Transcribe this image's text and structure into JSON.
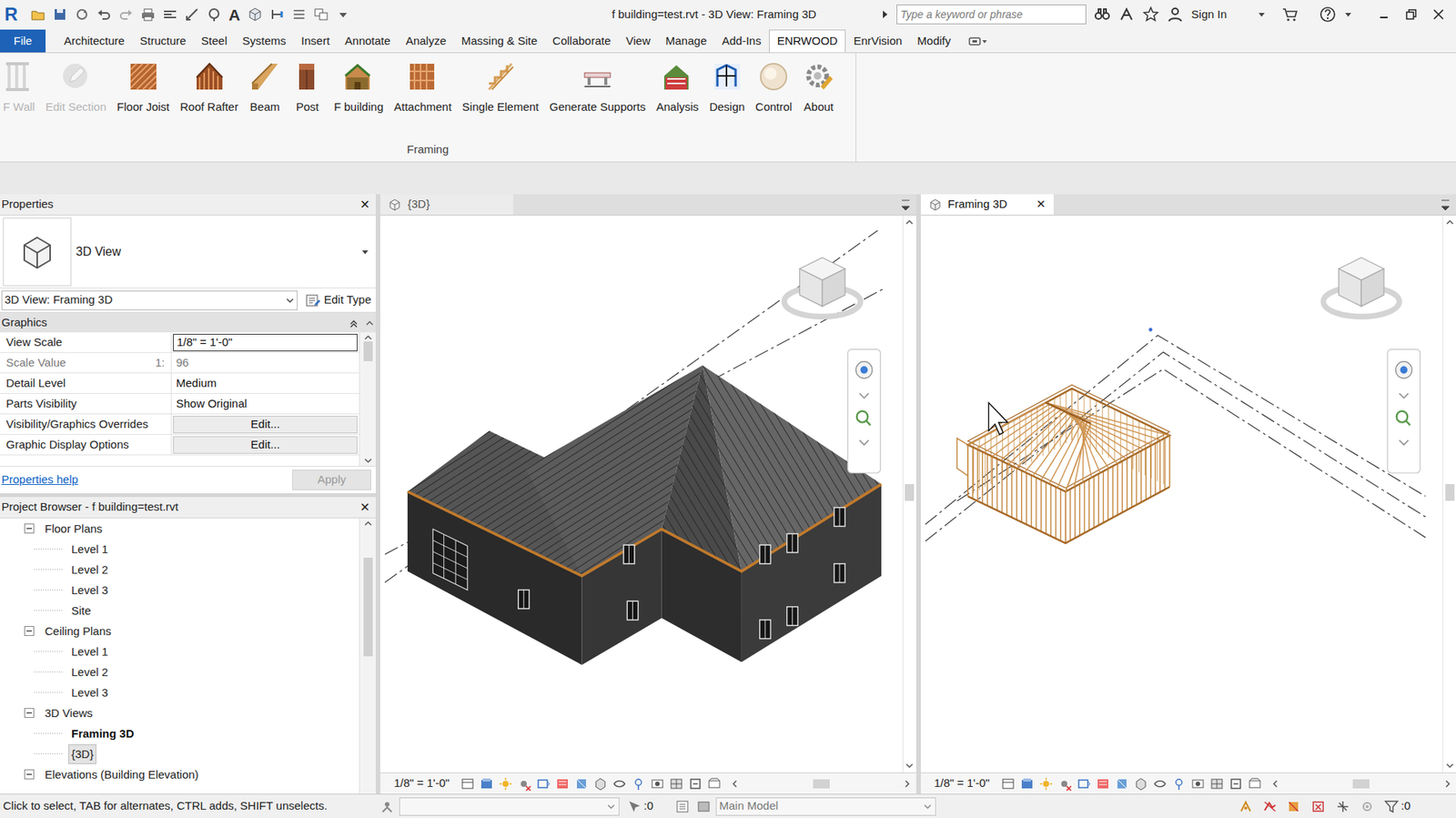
{
  "window": {
    "logo": "R",
    "text_glyph": "A",
    "title": "f building=test.rvt - 3D View: Framing 3D",
    "search_placeholder": "Type a keyword or phrase",
    "sign_in": "Sign In"
  },
  "file_tab": {
    "label": "File"
  },
  "menu_tabs": [
    {
      "label": "Architecture",
      "selected": false
    },
    {
      "label": "Structure",
      "selected": false
    },
    {
      "label": "Steel",
      "selected": false
    },
    {
      "label": "Systems",
      "selected": false
    },
    {
      "label": "Insert",
      "selected": false
    },
    {
      "label": "Annotate",
      "selected": false
    },
    {
      "label": "Analyze",
      "selected": false
    },
    {
      "label": "Massing & Site",
      "selected": false
    },
    {
      "label": "Collaborate",
      "selected": false
    },
    {
      "label": "View",
      "selected": false
    },
    {
      "label": "Manage",
      "selected": false
    },
    {
      "label": "Add-Ins",
      "selected": false
    },
    {
      "label": "ENRWOOD",
      "selected": true
    },
    {
      "label": "EnrVision",
      "selected": false
    },
    {
      "label": "Modify",
      "selected": false
    }
  ],
  "ribbon": {
    "panel": "Framing",
    "buttons": [
      {
        "label": "F Wall",
        "disabled": true
      },
      {
        "label": "Edit Section",
        "disabled": true
      },
      {
        "label": "Floor Joist",
        "disabled": false
      },
      {
        "label": "Roof Rafter",
        "disabled": false
      },
      {
        "label": "Beam",
        "disabled": false
      },
      {
        "label": "Post",
        "disabled": false
      },
      {
        "label": "F building",
        "disabled": false
      },
      {
        "label": "Attachment",
        "disabled": false
      },
      {
        "label": "Single Element",
        "disabled": false
      },
      {
        "label": "Generate Supports",
        "disabled": false
      },
      {
        "label": "Analysis",
        "disabled": false
      },
      {
        "label": "Design",
        "disabled": false
      },
      {
        "label": "Control",
        "disabled": false
      },
      {
        "label": "About",
        "disabled": false
      }
    ]
  },
  "properties": {
    "title": "Properties",
    "close": "✕",
    "type_name": "3D View",
    "instance": "3D View: Framing 3D",
    "edit_type": "Edit Type",
    "group": "Graphics",
    "rows": [
      {
        "label": "View Scale",
        "value": "1/8\" = 1'-0\"",
        "kind": "input",
        "disabled": false
      },
      {
        "label": "Scale Value",
        "suffix": "1:",
        "value": "96",
        "kind": "text",
        "disabled": true
      },
      {
        "label": "Detail Level",
        "value": "Medium",
        "kind": "text",
        "disabled": false
      },
      {
        "label": "Parts Visibility",
        "value": "Show Original",
        "kind": "text",
        "disabled": false
      },
      {
        "label": "Visibility/Graphics Overrides",
        "value": "Edit...",
        "kind": "button",
        "disabled": false
      },
      {
        "label": "Graphic Display Options",
        "value": "Edit...",
        "kind": "button",
        "disabled": false
      }
    ],
    "help": "Properties help",
    "apply": "Apply",
    "apply_disabled": true
  },
  "project_browser": {
    "title": "Project Browser - f building=test.rvt",
    "close": "✕",
    "items": [
      {
        "label": "Floor Plans",
        "kind": "group",
        "expanded": true,
        "selected": false,
        "active": false
      },
      {
        "label": "Level 1",
        "kind": "leaf",
        "expanded": false,
        "selected": false,
        "active": false
      },
      {
        "label": "Level 2",
        "kind": "leaf",
        "expanded": false,
        "selected": false,
        "active": false
      },
      {
        "label": "Level 3",
        "kind": "leaf",
        "expanded": false,
        "selected": false,
        "active": false
      },
      {
        "label": "Site",
        "kind": "leaf",
        "expanded": false,
        "selected": false,
        "active": false
      },
      {
        "label": "Ceiling Plans",
        "kind": "group",
        "expanded": true,
        "selected": false,
        "active": false
      },
      {
        "label": "Level 1",
        "kind": "leaf",
        "expanded": false,
        "selected": false,
        "active": false
      },
      {
        "label": "Level 2",
        "kind": "leaf",
        "expanded": false,
        "selected": false,
        "active": false
      },
      {
        "label": "Level 3",
        "kind": "leaf",
        "expanded": false,
        "selected": false,
        "active": false
      },
      {
        "label": "3D Views",
        "kind": "group",
        "expanded": true,
        "selected": false,
        "active": false
      },
      {
        "label": "Framing 3D",
        "kind": "leaf",
        "expanded": false,
        "selected": false,
        "active": true
      },
      {
        "label": "{3D}",
        "kind": "leaf",
        "expanded": false,
        "selected": true,
        "active": false
      },
      {
        "label": "Elevations (Building Elevation)",
        "kind": "group",
        "expanded": true,
        "selected": false,
        "active": false
      }
    ]
  },
  "views": [
    {
      "tab": "{3D}",
      "selected": false,
      "kind": "model",
      "scale": "1/8\" = 1'-0\""
    },
    {
      "tab": "Framing 3D",
      "selected": true,
      "kind": "framing",
      "close": "✕",
      "scale": "1/8\" = 1'-0\""
    }
  ],
  "status_bar": {
    "hint": "Click to select, TAB for alternates, CTRL adds, SHIFT unselects.",
    "selection_count": ":0",
    "model": "Main Model",
    "filter_count": ":0"
  }
}
